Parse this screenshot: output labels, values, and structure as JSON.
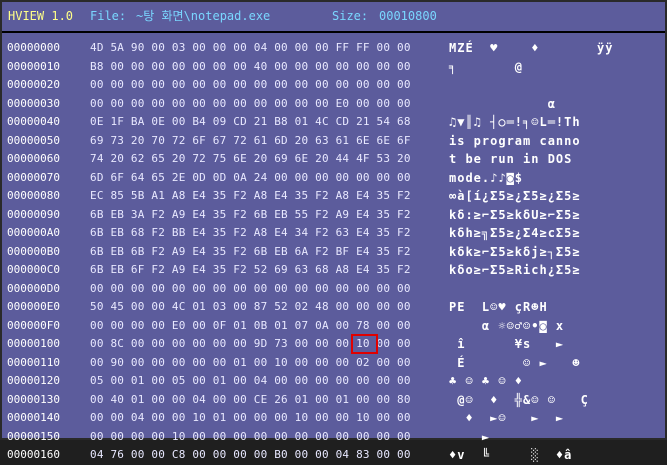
{
  "titlebar": {
    "app": "HVIEW 1.0",
    "file_label": "File:",
    "file_value": "~탕 화면\\notepad.exe",
    "size_label": "Size:",
    "size_value": "00010800"
  },
  "rows": [
    {
      "addr": "00000000",
      "hex": "4D 5A 90 00 03 00 00 00 04 00 00 00 FF FF 00 00",
      "ascii": "MZÉ  ♥    ♦       ÿÿ"
    },
    {
      "addr": "00000010",
      "hex": "B8 00 00 00 00 00 00 00 40 00 00 00 00 00 00 00",
      "ascii": "╕       @"
    },
    {
      "addr": "00000020",
      "hex": "00 00 00 00 00 00 00 00 00 00 00 00 00 00 00 00",
      "ascii": ""
    },
    {
      "addr": "00000030",
      "hex": "00 00 00 00 00 00 00 00 00 00 00 00 E0 00 00 00",
      "ascii": "            α"
    },
    {
      "addr": "00000040",
      "hex": "0E 1F BA 0E 00 B4 09 CD 21 B8 01 4C CD 21 54 68",
      "ascii": "♫▼║♫ ┤○═!╕☺L═!Th"
    },
    {
      "addr": "00000050",
      "hex": "69 73 20 70 72 6F 67 72 61 6D 20 63 61 6E 6E 6F",
      "ascii": "is program canno"
    },
    {
      "addr": "00000060",
      "hex": "74 20 62 65 20 72 75 6E 20 69 6E 20 44 4F 53 20",
      "ascii": "t be run in DOS "
    },
    {
      "addr": "00000070",
      "hex": "6D 6F 64 65 2E 0D 0D 0A 24 00 00 00 00 00 00 00",
      "ascii": "mode.♪♪◙$"
    },
    {
      "addr": "00000080",
      "hex": "EC 85 5B A1 A8 E4 35 F2 A8 E4 35 F2 A8 E4 35 F2",
      "ascii": "∞à[í¿Σ5≥¿Σ5≥¿Σ5≥"
    },
    {
      "addr": "00000090",
      "hex": "6B EB 3A F2 A9 E4 35 F2 6B EB 55 F2 A9 E4 35 F2",
      "ascii": "kδ:≥⌐Σ5≥kδU≥⌐Σ5≥"
    },
    {
      "addr": "000000A0",
      "hex": "6B EB 68 F2 BB E4 35 F2 A8 E4 34 F2 63 E4 35 F2",
      "ascii": "kδh≥╗Σ5≥¿Σ4≥cΣ5≥"
    },
    {
      "addr": "000000B0",
      "hex": "6B EB 6B F2 A9 E4 35 F2 6B EB 6A F2 BF E4 35 F2",
      "ascii": "kδk≥⌐Σ5≥kδj≥┐Σ5≥"
    },
    {
      "addr": "000000C0",
      "hex": "6B EB 6F F2 A9 E4 35 F2 52 69 63 68 A8 E4 35 F2",
      "ascii": "kδo≥⌐Σ5≥Rich¿Σ5≥"
    },
    {
      "addr": "000000D0",
      "hex": "00 00 00 00 00 00 00 00 00 00 00 00 00 00 00 00",
      "ascii": ""
    },
    {
      "addr": "000000E0",
      "hex": "50 45 00 00 4C 01 03 00 87 52 02 48 00 00 00 00",
      "ascii": "PE  L☺♥ çR☻H"
    },
    {
      "addr": "000000F0",
      "hex": "00 00 00 00 E0 00 0F 01 0B 01 07 0A 00 78 00 00",
      "ascii": "    α ☼☺♂☺•◙ x"
    },
    {
      "addr": "00000100",
      "hex": "00 8C 00 00 00 00 00 00 9D 73 00 00 00 10 00 00",
      "ascii": " î      ¥s   ►"
    },
    {
      "addr": "00000110",
      "hex": "00 90 00 00 00 00 00 01 00 10 00 00 00 02 00 00",
      "ascii": " É       ☺ ►   ☻"
    },
    {
      "addr": "00000120",
      "hex": "05 00 01 00 05 00 01 00 04 00 00 00 00 00 00 00",
      "ascii": "♣ ☺ ♣ ☺ ♦"
    },
    {
      "addr": "00000130",
      "hex": "00 40 01 00 00 04 00 00 CE 26 01 00 01 00 00 80",
      "ascii": " @☺  ♦  ╬&☺ ☺   Ç"
    },
    {
      "addr": "00000140",
      "hex": "00 00 04 00 00 10 01 00 00 00 10 00 00 10 00 00",
      "ascii": "  ♦  ►☺   ►  ►"
    },
    {
      "addr": "00000150",
      "hex": "00 00 00 00 10 00 00 00 00 00 00 00 00 00 00 00",
      "ascii": "    ►"
    },
    {
      "addr": "00000160",
      "hex": "04 76 00 00 C8 00 00 00 00 B0 00 00 04 83 00 00",
      "ascii": "♦v  ╚     ░  ♦â"
    }
  ],
  "highlight": {
    "row": "00000130",
    "byte": "01"
  }
}
